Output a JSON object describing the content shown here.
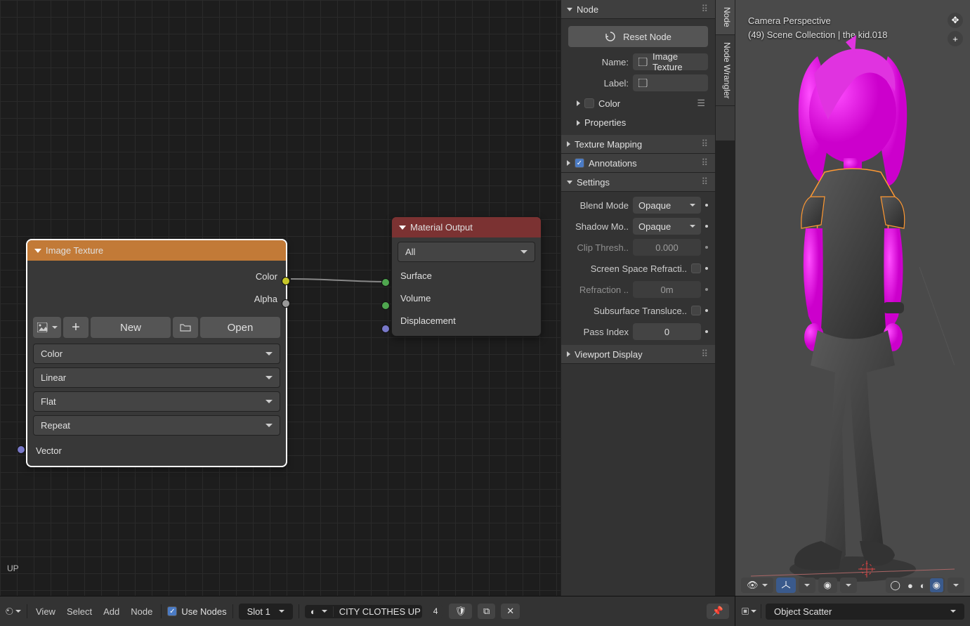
{
  "editor_overlay_text": "UP",
  "nodes": {
    "image_texture": {
      "title": "Image Texture",
      "output_color": "Color",
      "output_alpha": "Alpha",
      "new_btn": "New",
      "open_btn": "Open",
      "sel_colorspace": "Color",
      "sel_interp": "Linear",
      "sel_projection": "Flat",
      "sel_ext": "Repeat",
      "in_vector": "Vector"
    },
    "material_output": {
      "title": "Material Output",
      "target": "All",
      "surface": "Surface",
      "volume": "Volume",
      "displacement": "Displacement"
    }
  },
  "sidebar": {
    "tabs": {
      "node": "Node",
      "wrangler": "Node Wrangler"
    },
    "panels": {
      "node": {
        "title": "Node",
        "reset": "Reset Node",
        "name_label": "Name:",
        "name_value": "Image Texture",
        "label_label": "Label:",
        "color_row": "Color",
        "props_row": "Properties"
      },
      "texture_mapping": "Texture Mapping",
      "annotations": "Annotations",
      "settings": {
        "title": "Settings",
        "blend_mode_l": "Blend Mode",
        "blend_mode_v": "Opaque",
        "shadow_l": "Shadow Mo..",
        "shadow_v": "Opaque",
        "clip_l": "Clip Thresh..",
        "clip_v": "0.000",
        "ssr_l": "Screen Space Refracti..",
        "refr_l": "Refraction ..",
        "refr_v": "0m",
        "subs_l": "Subsurface Transluce..",
        "pass_l": "Pass Index",
        "pass_v": "0"
      },
      "viewport_display": "Viewport Display"
    }
  },
  "viewport": {
    "info_line1": "Camera Perspective",
    "info_line2": "(49) Scene Collection | the kid.018"
  },
  "footer": {
    "menus": [
      "View",
      "Select",
      "Add",
      "Node"
    ],
    "use_nodes": "Use Nodes",
    "slot": "Slot 1",
    "material": "CITY CLOTHES UP",
    "user_count": "4"
  },
  "footer_right": {
    "dropdown": "Object Scatter"
  }
}
